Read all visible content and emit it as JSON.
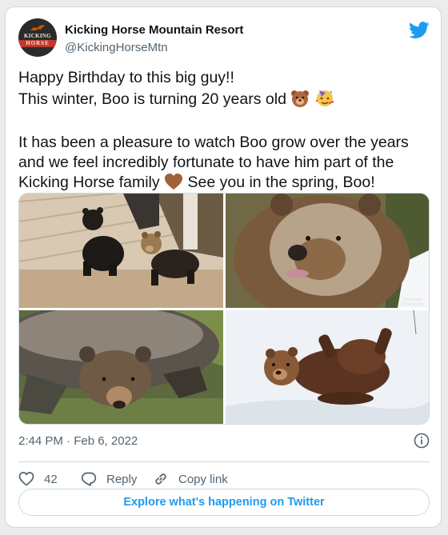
{
  "tweet": {
    "author_name": "Kicking Horse Mountain Resort",
    "author_handle": "@KickingHorseMtn",
    "avatar_lines": [
      "KICKING",
      "HORSE"
    ],
    "lines": [
      "Happy Birthday to this big guy!!",
      "This winter, Boo is turning 20 years old",
      "It has been a pleasure to watch Boo grow over the years",
      "and we feel incredibly fortunate to have him part of the",
      "Kicking Horse family",
      "See you in the spring, Boo!"
    ],
    "emojis": [
      "bear-face-emoji",
      "partying-face-emoji",
      "brown-heart-emoji"
    ],
    "photos": [
      {
        "subject": "two-bear-cubs"
      },
      {
        "subject": "grizzly-closeup",
        "watermark_line1": "Tom Adam",
        "watermark_line2": "Photography"
      },
      {
        "subject": "grizzly-resting"
      },
      {
        "subject": "bear-rolling-in-snow"
      }
    ],
    "timestamp": "2:44 PM · Feb 6, 2022",
    "like_count": "42",
    "reply_label": "Reply",
    "copy_link_label": "Copy link",
    "explore_label": "Explore what's happening on Twitter"
  },
  "colors": {
    "accent": "#1d9bf0",
    "text": "#0f1419",
    "muted": "#536471",
    "border": "#cfd9de"
  }
}
